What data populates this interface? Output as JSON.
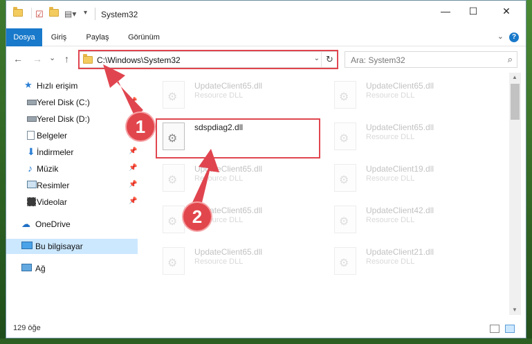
{
  "window": {
    "title": "System32",
    "minimize": "—",
    "maximize": "☐",
    "close": "✕"
  },
  "ribbon": {
    "tabs": [
      "Dosya",
      "Giriş",
      "Paylaş",
      "Görünüm"
    ],
    "help": "?",
    "collapse": "⌄"
  },
  "nav": {
    "back": "←",
    "forward": "→",
    "recent": "⌄",
    "up": "↑",
    "address": "C:\\Windows\\System32",
    "address_dropdown": "⌄",
    "refresh": "↻",
    "search_placeholder": "Ara: System32",
    "search_icon": "⌕"
  },
  "sidebar": {
    "items": [
      {
        "label": "Hızlı erişim",
        "icon": "star-icon"
      },
      {
        "label": "Yerel Disk (C:)",
        "icon": "drive-icon",
        "pinned": true
      },
      {
        "label": "Yerel Disk (D:)",
        "icon": "drive-icon",
        "pinned": true
      },
      {
        "label": "Belgeler",
        "icon": "documents-icon",
        "pinned": true
      },
      {
        "label": "İndirmeler",
        "icon": "download-icon",
        "pinned": true
      },
      {
        "label": "Müzik",
        "icon": "music-icon",
        "pinned": true
      },
      {
        "label": "Resimler",
        "icon": "pictures-icon",
        "pinned": true
      },
      {
        "label": "Videolar",
        "icon": "video-icon",
        "pinned": true
      },
      {
        "label": "OneDrive",
        "icon": "cloud-icon"
      },
      {
        "label": "Bu bilgisayar",
        "icon": "computer-icon",
        "selected": true
      },
      {
        "label": "Ağ",
        "icon": "network-icon"
      }
    ],
    "pin_glyph": "📌"
  },
  "files": [
    {
      "name": "UpdateClient65.dll",
      "type": "Resource DLL",
      "faded": true
    },
    {
      "name": "UpdateClient65.dll",
      "type": "Resource DLL",
      "faded": true
    },
    {
      "name": "sdspdiag2.dll",
      "type": "",
      "faded": false
    },
    {
      "name": "UpdateClient65.dll",
      "type": "Resource DLL",
      "faded": true
    },
    {
      "name": "UpdateClient65.dll",
      "type": "Resource DLL",
      "faded": true
    },
    {
      "name": "UpdateClient19.dll",
      "type": "Resource DLL",
      "faded": true
    },
    {
      "name": "UpdateClient65.dll",
      "type": "Resource DLL",
      "faded": true
    },
    {
      "name": "UpdateClient42.dll",
      "type": "Resource DLL",
      "faded": true
    },
    {
      "name": "UpdateClient65.dll",
      "type": "Resource DLL",
      "faded": true
    },
    {
      "name": "UpdateClient21.dll",
      "type": "Resource DLL",
      "faded": true
    }
  ],
  "status": {
    "count": "129 öğe"
  },
  "annotations": {
    "badge1": "1",
    "badge2": "2",
    "color": "#e0454f"
  }
}
